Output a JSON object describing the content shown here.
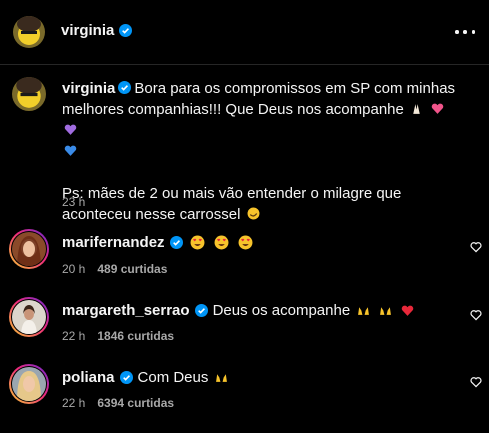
{
  "post": {
    "username": "virginia"
  },
  "caption": {
    "username": "virginia",
    "line1": "Bora para os compromissos em SP com minhas melhores companhias!!! Que Deus nos acompanhe",
    "line2": "Ps: mães de 2 ou mais vão entender o milagre que aconteceu nesse carrossel",
    "time": "23 h"
  },
  "comments": [
    {
      "username": "marifernandez",
      "text": "",
      "time": "20 h",
      "likes": "489 curtidas"
    },
    {
      "username": "margareth_serrao",
      "text": "Deus os acompanhe",
      "time": "22 h",
      "likes": "1846 curtidas"
    },
    {
      "username": "poliana",
      "text": "Com Deus",
      "time": "22 h",
      "likes": "6394 curtidas"
    }
  ],
  "icons": {
    "verified": "verified-badge-icon",
    "more": "more-options-icon",
    "like": "heart-outline-icon"
  },
  "colors": {
    "background": "#000000",
    "text": "#f5f5f5",
    "secondary": "#a8a8a8",
    "verified": "#0095f6"
  }
}
